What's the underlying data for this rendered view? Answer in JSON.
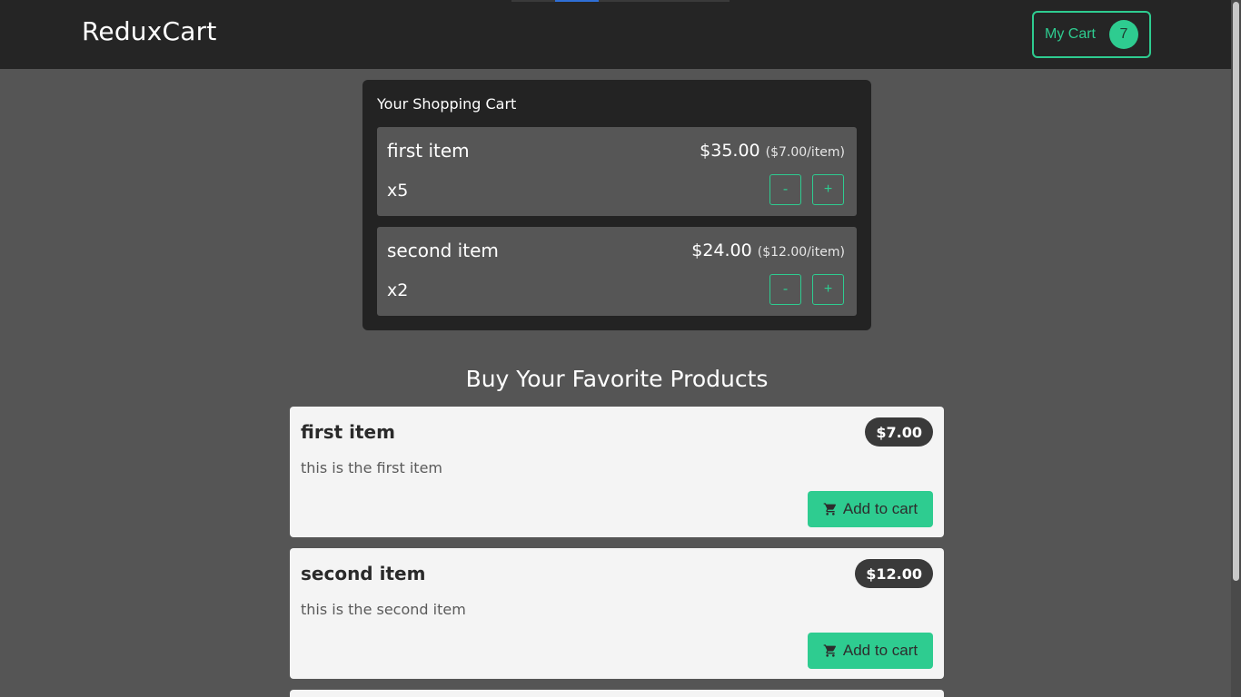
{
  "header": {
    "logo": "ReduxCart",
    "cart_button_label": "My Cart",
    "cart_count": "7"
  },
  "cart": {
    "title": "Your Shopping Cart",
    "items": [
      {
        "name": "first item",
        "total": "$35.00",
        "unit_price": "($7.00/item)",
        "quantity": "x5",
        "minus": "-",
        "plus": "+"
      },
      {
        "name": "second item",
        "total": "$24.00",
        "unit_price": "($12.00/item)",
        "quantity": "x2",
        "minus": "-",
        "plus": "+"
      }
    ]
  },
  "products": {
    "title": "Buy Your Favorite Products",
    "items": [
      {
        "name": "first item",
        "price": "$7.00",
        "description": "this is the first item",
        "button_label": "Add to cart",
        "icon": "shopping-cart-icon"
      },
      {
        "name": "second item",
        "price": "$12.00",
        "description": "this is the second item",
        "button_label": "Add to cart",
        "icon": "shopping-cart-icon"
      }
    ]
  },
  "colors": {
    "accent": "#2ecc90",
    "header_bg": "#252525",
    "page_bg": "#555555",
    "card_bg": "#f4f4f4"
  }
}
